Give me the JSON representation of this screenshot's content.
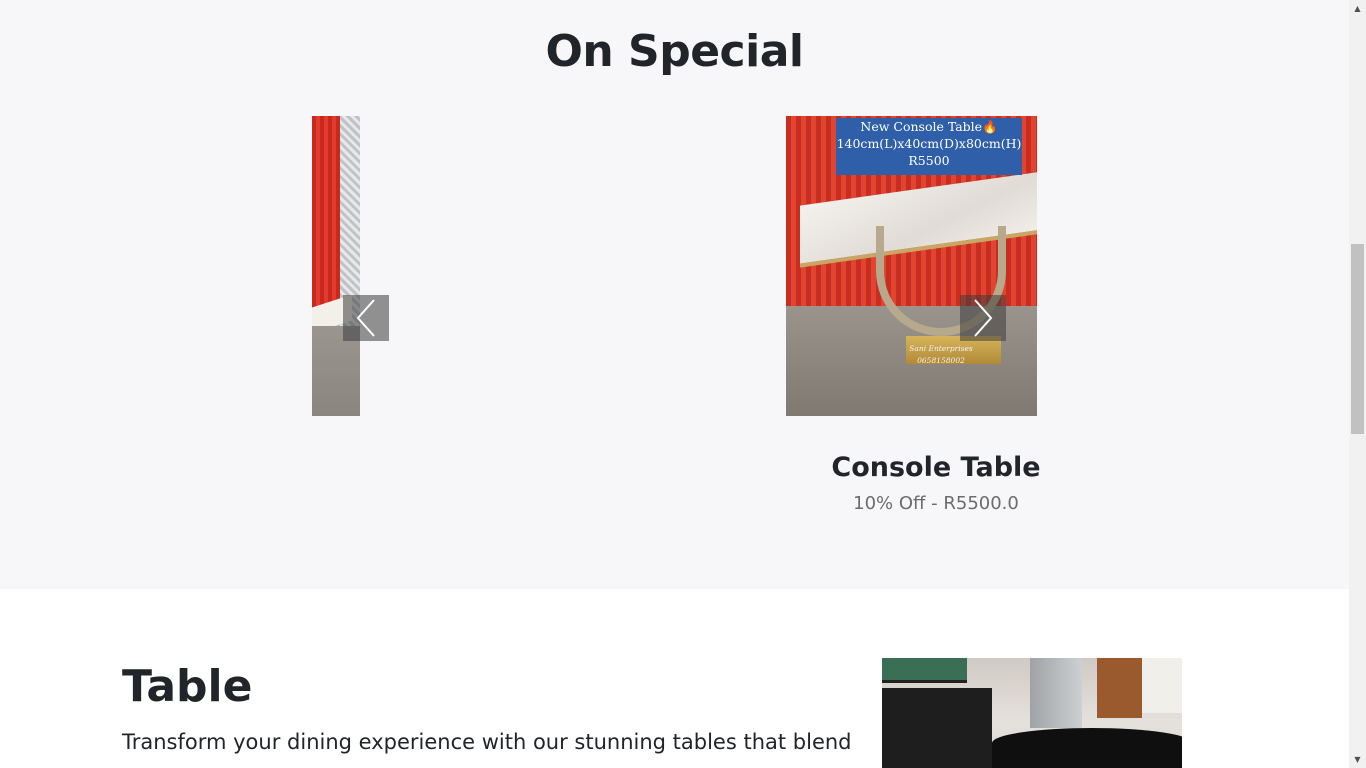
{
  "special": {
    "title": "On Special",
    "banner": {
      "line1": "New Console Table🔥",
      "line2": "140cm(L)x40cm(D)x80cm(H)",
      "line3": "R5500"
    },
    "watermark": {
      "line1": "Sani Enterprises",
      "line2": "0658158002"
    },
    "product": {
      "name": "Console Table",
      "price": "10% Off - R5500.0"
    },
    "prev_icon": "chevron-left-icon",
    "next_icon": "chevron-right-icon"
  },
  "table_section": {
    "heading": "Table",
    "description": "Transform your dining experience with our stunning tables that blend"
  },
  "colors": {
    "special_bg": "#f7f7f9",
    "banner_bg": "#2e5fa8",
    "text": "#212529",
    "muted": "#6c6c6c"
  }
}
